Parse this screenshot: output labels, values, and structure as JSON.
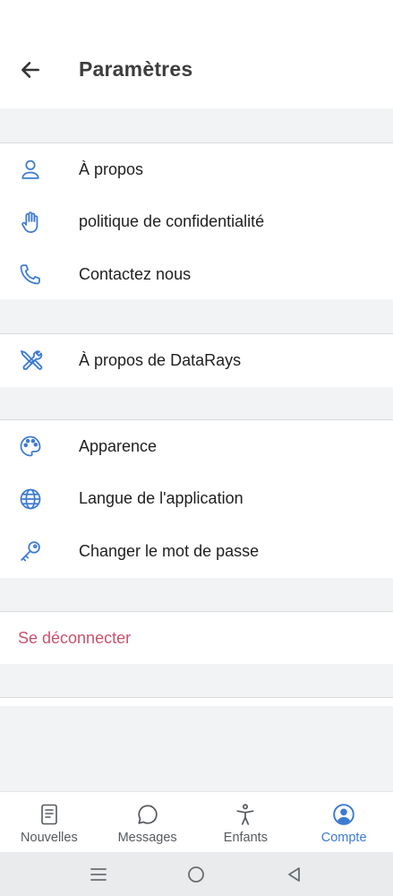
{
  "header": {
    "title": "Paramètres",
    "back_icon": "arrow-left-icon"
  },
  "groups": [
    {
      "items": [
        {
          "label": "À propos",
          "icon": "user-icon"
        },
        {
          "label": "politique de confidentialité",
          "icon": "hand-icon"
        },
        {
          "label": "Contactez nous",
          "icon": "phone-icon"
        }
      ]
    },
    {
      "items": [
        {
          "label": "À propos de DataRays",
          "icon": "tools-icon"
        }
      ]
    },
    {
      "items": [
        {
          "label": "Apparence",
          "icon": "palette-icon"
        },
        {
          "label": "Langue de l'application",
          "icon": "globe-icon"
        },
        {
          "label": "Changer le mot de passe",
          "icon": "key-icon"
        }
      ]
    }
  ],
  "logout": {
    "label": "Se déconnecter",
    "color": "#c9526e"
  },
  "bottom_nav": {
    "items": [
      {
        "label": "Nouvelles",
        "icon": "news-icon",
        "active": false
      },
      {
        "label": "Messages",
        "icon": "chat-bubble-icon",
        "active": false
      },
      {
        "label": "Enfants",
        "icon": "accessibility-icon",
        "active": false
      },
      {
        "label": "Compte",
        "icon": "account-circle-icon",
        "active": true
      }
    ],
    "active_color": "#3d7bd1"
  },
  "system_bar": {
    "icons": [
      "menu-icon",
      "home-circle-icon",
      "back-triangle-icon"
    ]
  },
  "colors": {
    "icon_blue": "#3d7bd1",
    "background": "#f1f3f5"
  }
}
